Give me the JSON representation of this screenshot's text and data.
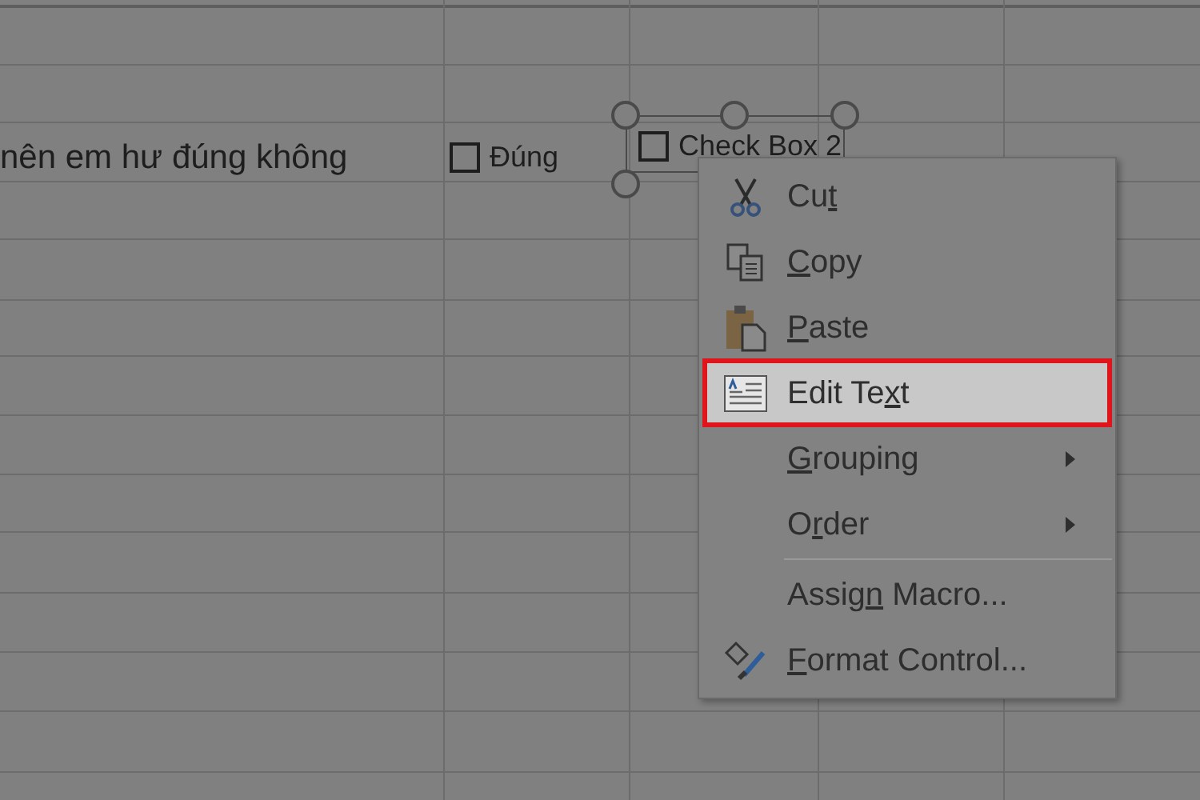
{
  "sheet": {
    "cell_text": "nên em hư đúng không",
    "checkboxes": [
      {
        "label": "Đúng",
        "checked": false,
        "selected": false
      },
      {
        "label": "Check Box 2",
        "checked": false,
        "selected": true
      }
    ]
  },
  "context_menu": {
    "items": [
      {
        "kind": "item",
        "before": "Cu",
        "key": "t",
        "selected": false,
        "submenu": false
      },
      {
        "kind": "item",
        "key": "C",
        "after": "opy",
        "selected": false,
        "submenu": false
      },
      {
        "kind": "item",
        "key": "P",
        "after": "aste",
        "selected": false,
        "submenu": false
      },
      {
        "kind": "item",
        "before": "Edit Te",
        "key": "x",
        "after": "t",
        "selected": true,
        "submenu": false
      },
      {
        "kind": "item",
        "key": "G",
        "after": "rouping",
        "selected": false,
        "submenu": true
      },
      {
        "kind": "item",
        "before": "O",
        "key": "r",
        "after": "der",
        "selected": false,
        "submenu": true
      },
      {
        "kind": "separator"
      },
      {
        "kind": "item",
        "before": "Assig",
        "key": "n",
        "after": " Macro...",
        "selected": false,
        "submenu": false
      },
      {
        "kind": "item",
        "key": "F",
        "after": "ormat Control...",
        "selected": false,
        "submenu": false
      }
    ]
  }
}
